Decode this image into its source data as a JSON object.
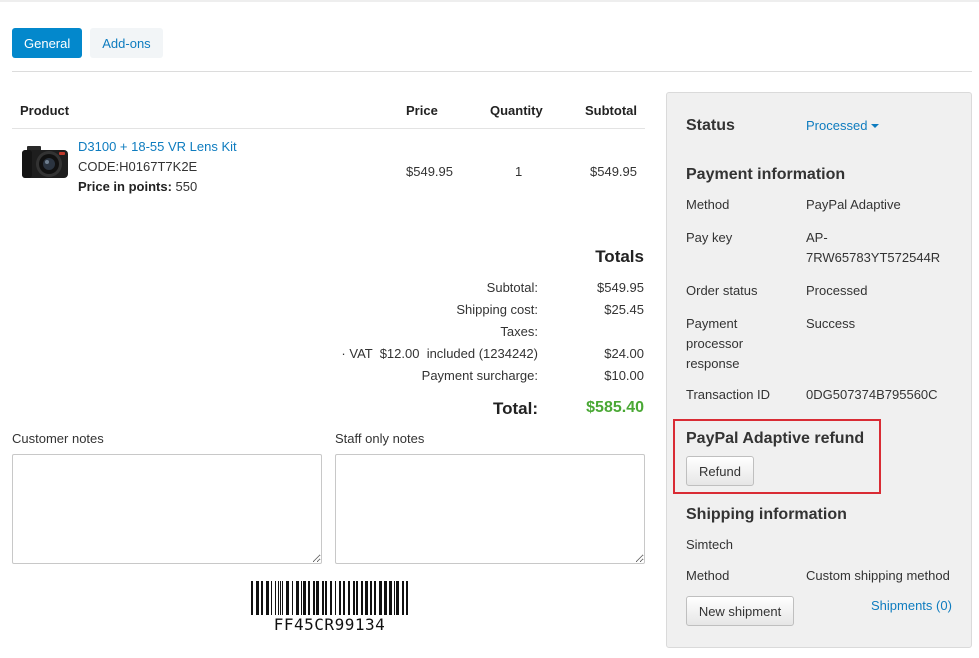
{
  "tabs": [
    {
      "label": "General",
      "active": true
    },
    {
      "label": "Add-ons",
      "active": false
    }
  ],
  "products": {
    "headers": {
      "product": "Product",
      "price": "Price",
      "quantity": "Quantity",
      "subtotal": "Subtotal"
    },
    "rows": [
      {
        "name": "D3100 + 18-55 VR Lens Kit",
        "code": "CODE:H0167T7K2E",
        "points_label": "Price in points:",
        "points_value": "550",
        "price": "$549.95",
        "quantity": "1",
        "subtotal": "$549.95",
        "image_icon": "camera-icon"
      }
    ]
  },
  "totals": {
    "title": "Totals",
    "subtotal_label": "Subtotal:",
    "subtotal_value": "$549.95",
    "shipping_label": "Shipping cost:",
    "shipping_value": "$25.45",
    "taxes_label": "Taxes:",
    "vat_label": "· VAT  $12.00  included (1234242)",
    "vat_value": "$24.00",
    "surcharge_label": "Payment surcharge:",
    "surcharge_value": "$10.00",
    "total_label": "Total:",
    "total_value": "$585.40",
    "total_color": "#4aa835"
  },
  "notes": {
    "customer_label": "Customer notes",
    "staff_label": "Staff only notes"
  },
  "barcode": {
    "text": "FF45CR99134"
  },
  "sidebar": {
    "status_label": "Status",
    "status_value": "Processed",
    "payment_title": "Payment information",
    "method_label": "Method",
    "method_value": "PayPal Adaptive",
    "paykey_label": "Pay key",
    "paykey_value_line1": "AP-",
    "paykey_value_line2": "7RW65783YT572544R",
    "order_status_label": "Order status",
    "order_status_value": "Processed",
    "ppr_label_line1": "Payment",
    "ppr_label_line2": "processor",
    "ppr_label_line3": "response",
    "ppr_value": "Success",
    "transaction_label": "Transaction ID",
    "transaction_value": "0DG507374B795560C",
    "refund_title": "PayPal Adaptive refund",
    "refund_button": "Refund",
    "shipping_title": "Shipping information",
    "shipping_company": "Simtech",
    "ship_method_label": "Method",
    "ship_method_value": "Custom shipping method",
    "new_shipment_button": "New shipment",
    "shipments_link": "Shipments (0)"
  },
  "colors": {
    "accent": "#0388cc",
    "link": "#0e7cbf",
    "highlight": "#d92b34"
  }
}
